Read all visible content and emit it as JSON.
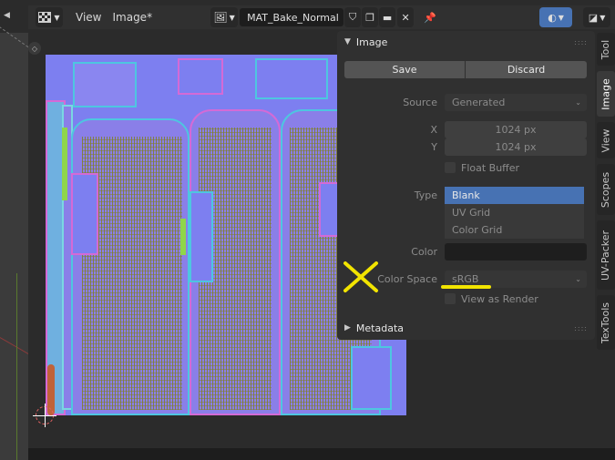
{
  "header": {
    "menus": [
      "View",
      "Image*"
    ],
    "image_name": "MAT_Bake_Normal"
  },
  "panel": {
    "title": "Image",
    "save_label": "Save",
    "discard_label": "Discard",
    "source_label": "Source",
    "source_value": "Generated",
    "x_label": "X",
    "x_value": "1024 px",
    "y_label": "Y",
    "y_value": "1024 px",
    "float_buffer_label": "Float Buffer",
    "type_label": "Type",
    "type_options": [
      "Blank",
      "UV Grid",
      "Color Grid"
    ],
    "type_selected": "Blank",
    "color_label": "Color",
    "color_value": "#1e1e1e",
    "color_space_label": "Color Space",
    "color_space_value": "sRGB",
    "view_as_render_label": "View as Render"
  },
  "metadata": {
    "title": "Metadata"
  },
  "tabs": [
    "Tool",
    "Image",
    "View",
    "Scopes",
    "UV-Packer",
    "TexTools"
  ],
  "active_tab": "Image",
  "colors": {
    "accent": "#4772b3",
    "normal_map_base": "#7d7ff0",
    "annotation": "#f2e400"
  }
}
